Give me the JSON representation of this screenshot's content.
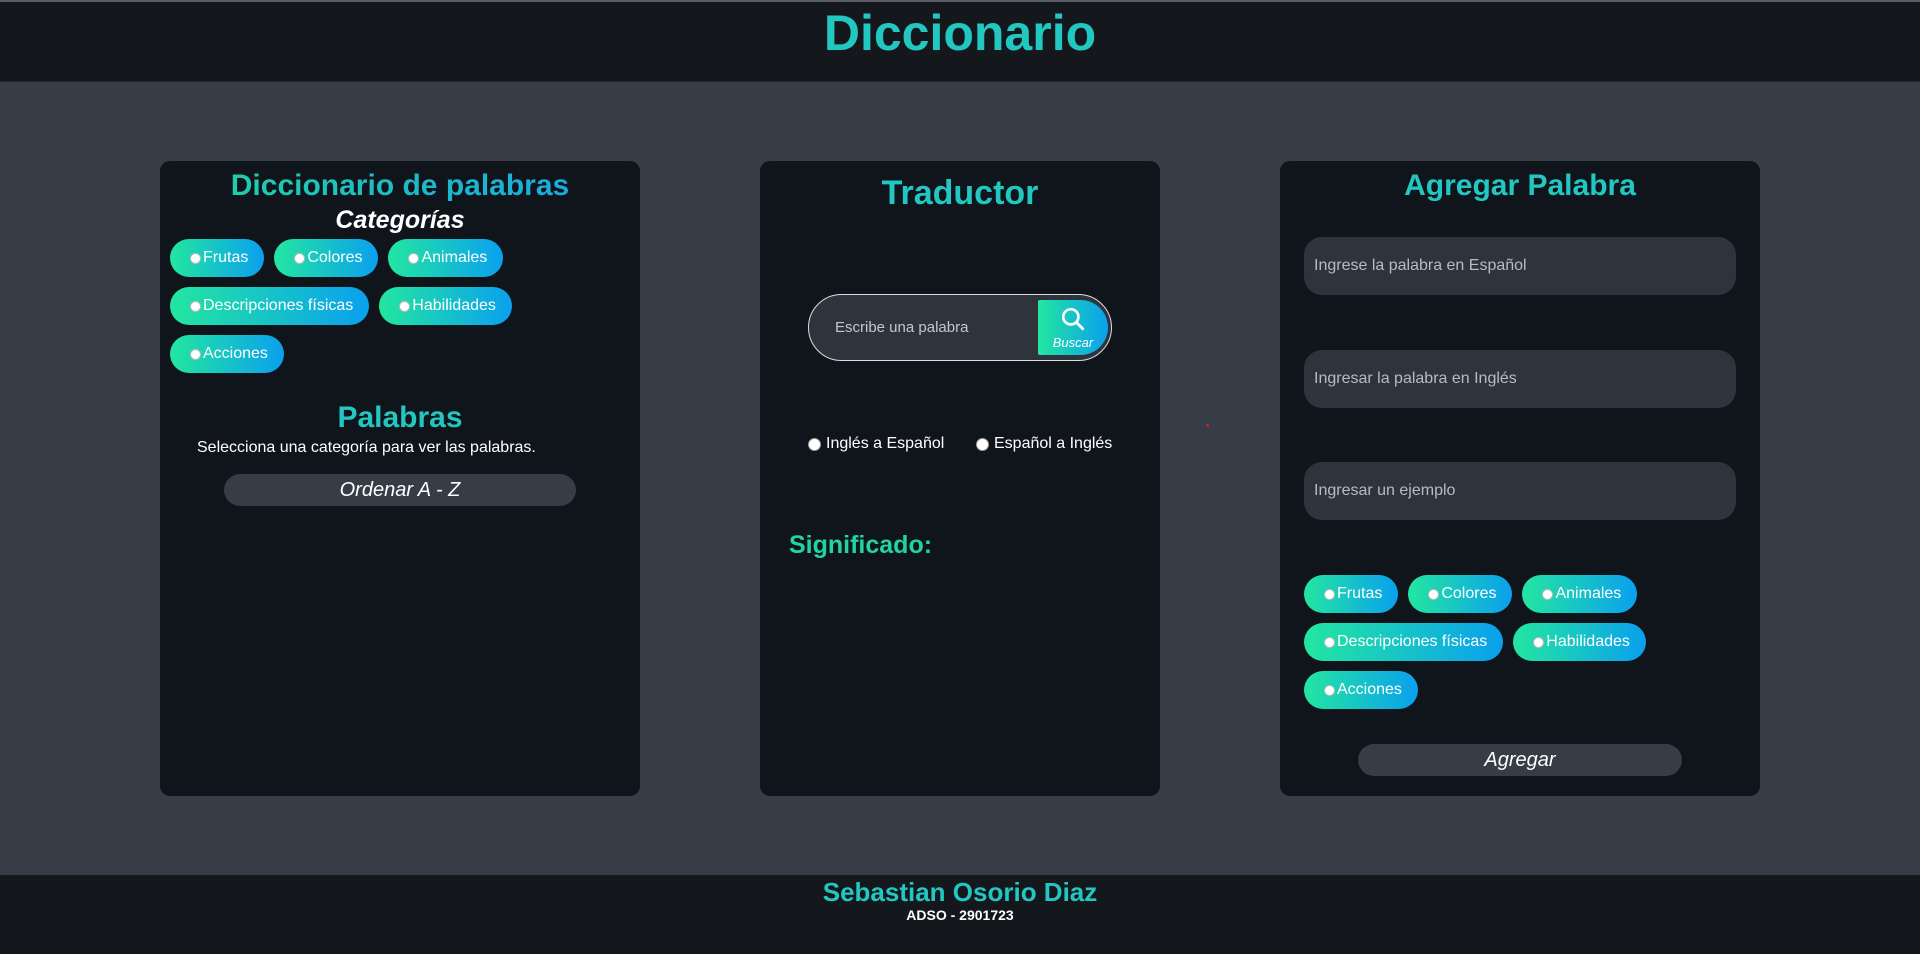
{
  "header": {
    "title": "Diccionario"
  },
  "dictionary_panel": {
    "title": "Diccionario de palabras",
    "categories_title": "Categorías",
    "categories": [
      "Frutas",
      "Colores",
      "Animales",
      "Descripciones físicas",
      "Habilidades",
      "Acciones"
    ],
    "words_title": "Palabras",
    "words_hint": "Selecciona una categoría para ver las palabras.",
    "sort_label": "Ordenar A - Z"
  },
  "translator_panel": {
    "title": "Traductor",
    "search_placeholder": "Escribe una palabra",
    "search_button_label": "Buscar",
    "direction_options": [
      "Inglés a Español",
      "Español a Inglés"
    ],
    "meaning_label": "Significado:"
  },
  "add_panel": {
    "title": "Agregar Palabra",
    "spanish_placeholder": "Ingrese la palabra en Español",
    "english_placeholder": "Ingresar la palabra en Inglés",
    "example_placeholder": "Ingresar un ejemplo",
    "categories": [
      "Frutas",
      "Colores",
      "Animales",
      "Descripciones físicas",
      "Habilidades",
      "Acciones"
    ],
    "add_button_label": "Agregar"
  },
  "footer": {
    "author": "Sebastian Osorio Diaz",
    "code": "ADSO - 2901723"
  },
  "colors": {
    "accent_teal": "#22c7c2",
    "gradient_start": "#23e6a0",
    "gradient_end": "#0aa0ee",
    "panel_bg": "#10151c",
    "page_bg": "#363d46"
  },
  "icons": {
    "search_button": "search-icon"
  }
}
